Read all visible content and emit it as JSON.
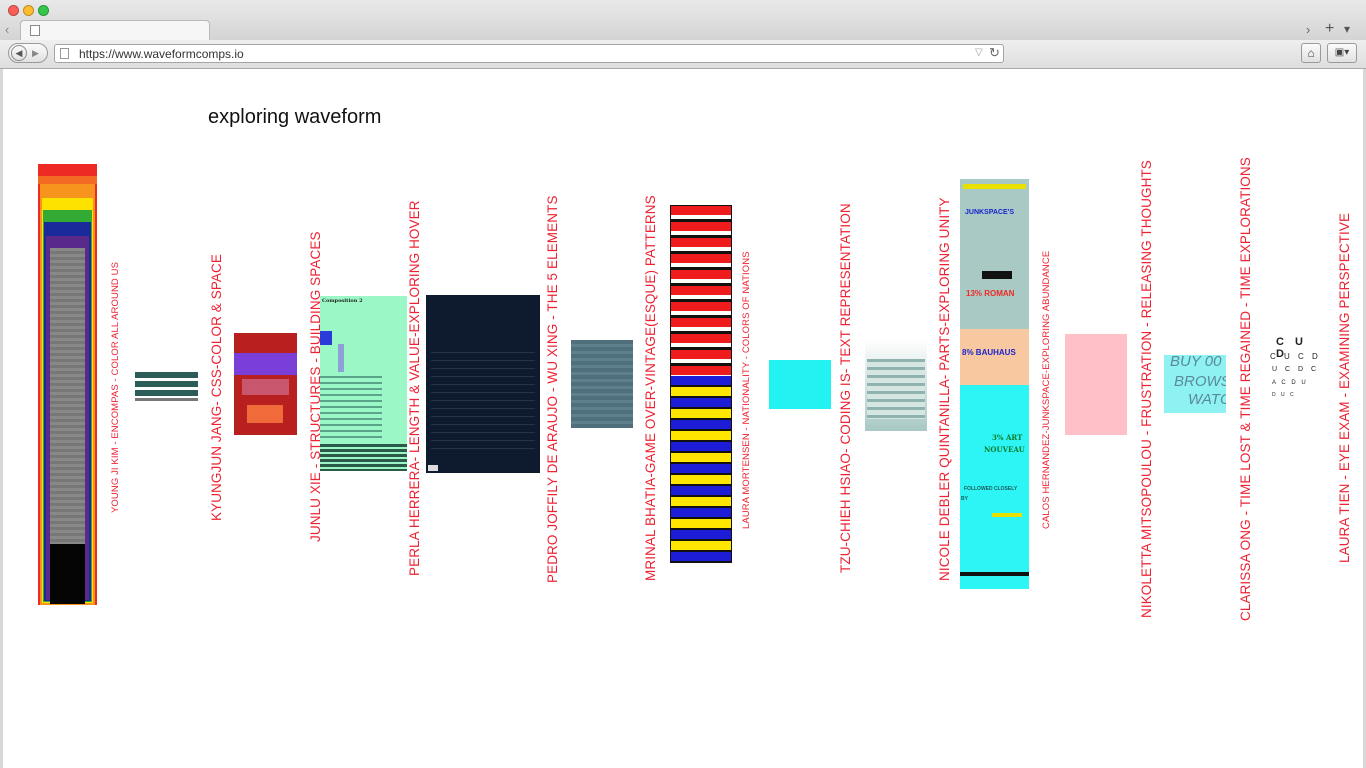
{
  "browser": {
    "url": "https://www.waveformcomps.io",
    "nav_back_icon": "arrow-left-icon",
    "nav_forward_icon": "arrow-right-icon",
    "home_icon": "home-icon"
  },
  "page": {
    "title": "exploring waveform"
  },
  "colors": {
    "label": "#ee2233",
    "background": "#ffffff"
  },
  "projects": [
    {
      "label": "YOUNG JI KIM - ENCOMPAS - COLOR ALL AROUND US"
    },
    {
      "label": "KYUNGJUN JANG- CSS-COLOR & SPACE"
    },
    {
      "label": "JUNLU XIE - STRUCTURES - BUILDING SPACES"
    },
    {
      "label": "PERLA HERRERA- LENGTH & VALUE-EXPLORING HOVER"
    },
    {
      "label": "PEDRO JOFFILY DE ARAUJO - WU XING - THE 5 ELEMENTS"
    },
    {
      "label": "MRINAL BHATIA-GAME OVER-VINTAGE(ESQUE) PATTERNS"
    },
    {
      "label": "LAURA MORTENSEN - NATIONALITY - COLORS OF NATIONS"
    },
    {
      "label": "TZU-CHIEH HSIAO- CODING IS- TEXT REPRESENTATION"
    },
    {
      "label": "NICOLE DEBLER QUINTANILLA- PARTS-EXPLORING UNITY"
    },
    {
      "label": "CALOS HERNANDEZ-JUNKSPACE-EXPLORING ABUNDANCE"
    },
    {
      "label": "NIKOLETTA MITSOPOULOU - FRUSTRATION - RELEASING THOUGHTS"
    },
    {
      "label": "CLARISSA ONG - TIME LOST & TIME REGAINED - TIME EXPLORATIONS"
    },
    {
      "label": "LAURA TIEN - EYE EXAM - EXAMINING PERSPECTIVE"
    }
  ],
  "thumb_text": {
    "composition": "Composition 2",
    "junkspace": "JUNKSPACE'S",
    "roman": "13% ROMAN",
    "bauhaus": "8% BAUHAUS",
    "art_nouveau_pct": "3% ART",
    "art_nouveau": "NOUVEAU",
    "followed": "FOLLOWED CLOSELY",
    "by": "BY",
    "buy": "BUY 00",
    "brows": "BROWS",
    "watch": "WATCH"
  }
}
